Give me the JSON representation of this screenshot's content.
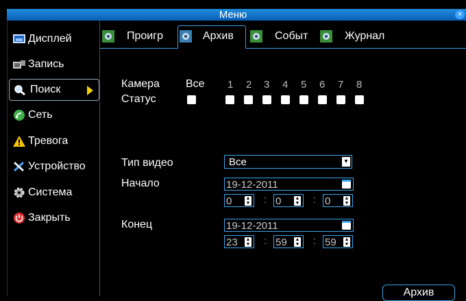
{
  "window": {
    "title": "Меню",
    "close_icon": "close-icon"
  },
  "sidebar": {
    "items": [
      {
        "label": "Дисплей",
        "icon": "display-icon"
      },
      {
        "label": "Запись",
        "icon": "record-icon"
      },
      {
        "label": "Поиск",
        "icon": "search-icon",
        "active": true
      },
      {
        "label": "Сеть",
        "icon": "network-icon"
      },
      {
        "label": "Тревога",
        "icon": "alarm-icon"
      },
      {
        "label": "Устройство",
        "icon": "tools-icon"
      },
      {
        "label": "Система",
        "icon": "gear-icon"
      },
      {
        "label": "Закрыть",
        "icon": "power-icon"
      }
    ]
  },
  "tabs": [
    {
      "label": "Проигр",
      "icon": "camera-icon"
    },
    {
      "label": "Архив",
      "icon": "camera-icon",
      "active": true
    },
    {
      "label": "Событ",
      "icon": "camera-icon"
    },
    {
      "label": "Журнал",
      "icon": "camera-icon"
    }
  ],
  "camera": {
    "label": "Камера",
    "status_label": "Статус",
    "all_label": "Все",
    "numbers": [
      "1",
      "2",
      "3",
      "4",
      "5",
      "6",
      "7",
      "8"
    ]
  },
  "video_type": {
    "label": "Тип видео",
    "value": "Все"
  },
  "start": {
    "label": "Начало",
    "date": "19-12-2011",
    "hour": "0",
    "minute": "0",
    "second": "0"
  },
  "end": {
    "label": "Конец",
    "date": "19-12-2011",
    "hour": "23",
    "minute": "59",
    "second": "59"
  },
  "time_separator": ":",
  "archive_button": "Архив",
  "colors": {
    "accent": "#39a0e6",
    "title_band": "#1f8cdc",
    "arrow": "#f4d000"
  }
}
